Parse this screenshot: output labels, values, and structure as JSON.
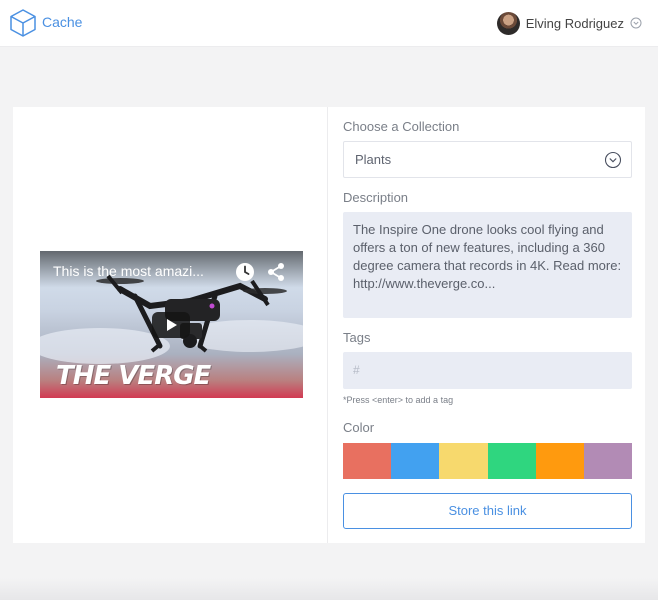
{
  "header": {
    "brand": "Cache",
    "logo_icon": "cube-icon",
    "user_name": "Elving Rodriguez",
    "user_menu_icon": "chevron-down-circle-icon"
  },
  "video": {
    "title": "This is the most amazi...",
    "logo_text": "THE VERGE",
    "icons": [
      "clock-icon",
      "share-icon",
      "play-icon"
    ]
  },
  "form": {
    "collection_label": "Choose a Collection",
    "collection_value": "Plants",
    "description_label": "Description",
    "description_text": "The Inspire One drone looks cool flying and offers a ton of new features, including a 360 degree camera that records in 4K. Read more: http://www.theverge.co...",
    "tags_label": "Tags",
    "tags_placeholder": "#",
    "tags_hint": "*Press <enter> to add a tag",
    "color_label": "Color",
    "colors": [
      "#e87060",
      "#42a1f0",
      "#f7d96d",
      "#2fd67f",
      "#ff9a0e",
      "#b28bb5"
    ],
    "submit_label": "Store this link"
  },
  "colors": {
    "accent": "#4a90e2",
    "field_bg": "#e9ecf4"
  }
}
